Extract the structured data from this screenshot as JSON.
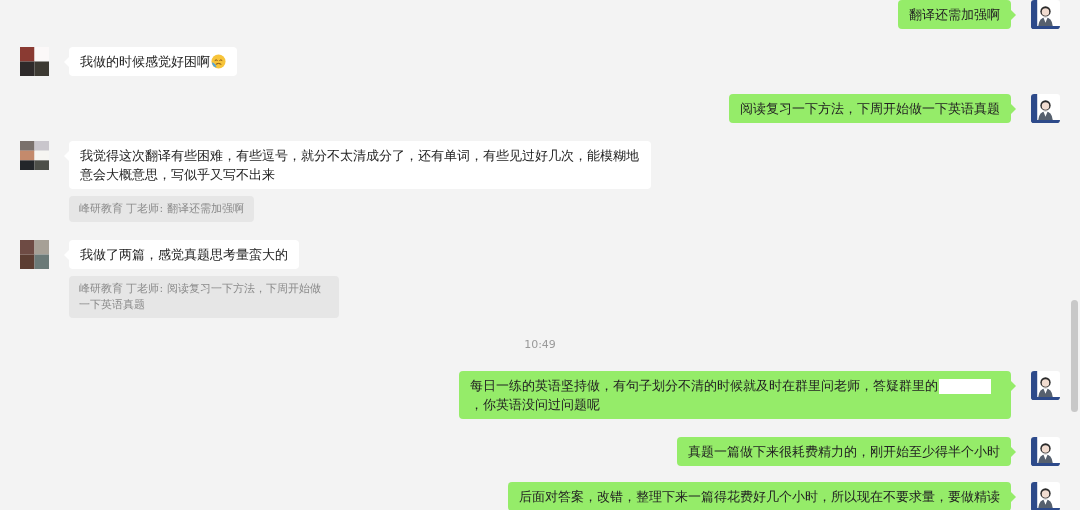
{
  "messages": [
    {
      "kind": "sent",
      "text": "翻译还需加强啊"
    },
    {
      "kind": "received",
      "text": "我做的时候感觉好困啊",
      "has_emoji": true
    },
    {
      "kind": "sent",
      "text": "阅读复习一下方法，下周开始做一下英语真题"
    },
    {
      "kind": "received",
      "text": "我觉得这次翻译有些困难，有些逗号，就分不太清成分了，还有单词，有些见过好几次，能模糊地意会大概意思，写似乎又写不出来",
      "quote": "峰研教育 丁老师: 翻译还需加强啊"
    },
    {
      "kind": "received",
      "text": "我做了两篇，感觉真题思考量蛮大的",
      "quote": "峰研教育 丁老师: 阅读复习一下方法，下周开始做一下英语真题"
    },
    {
      "kind": "time",
      "text": "10:49"
    },
    {
      "kind": "sent",
      "text": "每日一练的英语坚持做，有句子划分不清的时候就及时在群里问老师，答疑群里的",
      "redacted": true,
      "text_after": "，你英语没问过问题呢"
    },
    {
      "kind": "sent",
      "text": "真题一篇做下来很耗费精力的，刚开始至少得半个小时"
    },
    {
      "kind": "sent",
      "text": "后面对答案，改错，整理下来一篇得花费好几个小时，所以现在不要求量，要做精读"
    }
  ]
}
